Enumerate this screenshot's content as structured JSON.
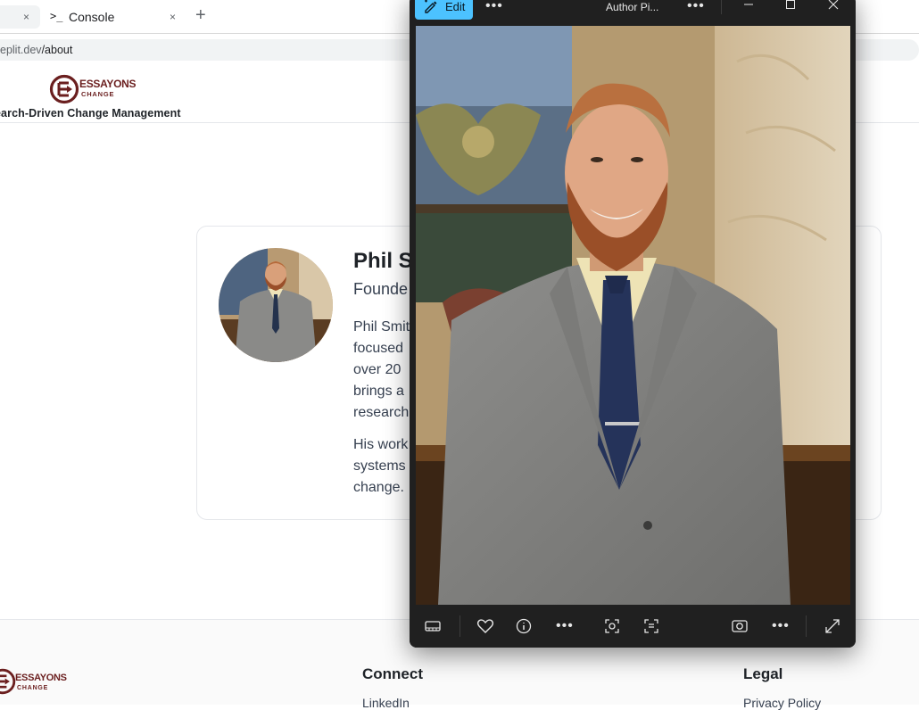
{
  "browser": {
    "tabs": [
      {
        "label": "",
        "close_glyph": "×"
      },
      {
        "label": "Console",
        "icon": ">_",
        "close_glyph": "×"
      }
    ],
    "new_tab_glyph": "+",
    "url_host": "eplit.dev",
    "url_path": "/about"
  },
  "site": {
    "logo_top": "ESSAYONS",
    "logo_bottom": "CHANGE",
    "tagline": "earch-Driven Change Management"
  },
  "about": {
    "name": "Phil S",
    "role": "Founde",
    "bio_lines": [
      "Phil Smit",
      "focused",
      "over 20",
      "brings a",
      "research"
    ],
    "bio_lines_2": [
      "His work",
      "systems",
      "change."
    ]
  },
  "footer": {
    "logo_top": "ESSAYONS",
    "logo_bottom": "CHANGE",
    "connect_heading": "Connect",
    "connect_link": "LinkedIn",
    "legal_heading": "Legal",
    "legal_link": "Privacy Policy"
  },
  "viewer": {
    "edit_label": "Edit",
    "title": "Author Pi...",
    "more_glyph": "•••",
    "accent_color": "#4cc2ff",
    "background_color": "#202020",
    "toolbar_icons": [
      "filmstrip-icon",
      "heart-icon",
      "info-icon",
      "more-icon",
      "visual-search-icon",
      "text-scan-icon",
      "screenshot-icon",
      "more-icon",
      "expand-icon"
    ]
  },
  "colors": {
    "brand": "#6b1f1f",
    "text": "#1f2328",
    "border": "#e5e7eb"
  }
}
